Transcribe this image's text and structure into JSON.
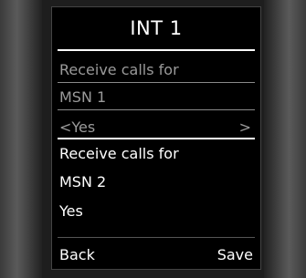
{
  "header": {
    "title": "INT  1"
  },
  "setting_1": {
    "label_line1": "Receive calls for",
    "label_line2": "MSN 1",
    "value_prefix": "<",
    "value": "Yes",
    "value_suffix": ">"
  },
  "setting_2": {
    "label_line1": "Receive calls for",
    "label_line2": "MSN 2",
    "value": "Yes"
  },
  "softkeys": {
    "left": "Back",
    "right": "Save"
  }
}
